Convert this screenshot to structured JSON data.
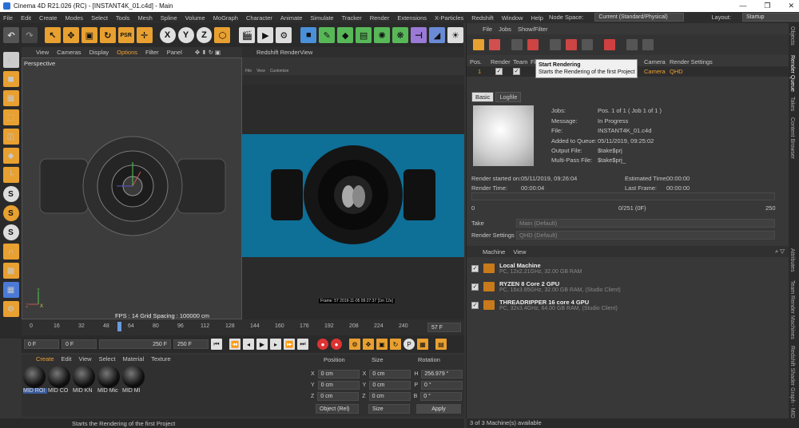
{
  "title": "Cinema 4D R21.026 (RC) - [INSTANT4K_01.c4d] - Main",
  "menu": [
    "File",
    "Edit",
    "Create",
    "Modes",
    "Select",
    "Tools",
    "Mesh",
    "Spline",
    "Volume",
    "MoGraph",
    "Character",
    "Animate",
    "Simulate",
    "Tracker",
    "Render",
    "Extensions",
    "X-Particles",
    "Redshift",
    "Window",
    "Help"
  ],
  "node_space": {
    "label": "Node Space:",
    "value": "Current (Standard/Physical)"
  },
  "layout": {
    "label": "Layout:",
    "value": "Startup"
  },
  "axis_buttons": [
    "X",
    "Y",
    "Z"
  ],
  "viewport": {
    "menu": [
      "View",
      "Cameras",
      "Display",
      "Options",
      "Filter",
      "Panel"
    ],
    "label": "Perspective",
    "fps": "FPS : 14",
    "grid": "Grid Spacing : 100000 cm"
  },
  "renderview": {
    "title": "Redshift RenderView",
    "menu": [
      "File",
      "View",
      "Customize"
    ],
    "frame_info": "Frame: 57  2019-11-05  09:27:37  [1m 12s]"
  },
  "timeline": {
    "ticks": [
      "0",
      "16",
      "32",
      "48",
      "64",
      "80",
      "96",
      "112",
      "128",
      "144",
      "160",
      "176",
      "192",
      "208",
      "224",
      "240"
    ],
    "current": "57 F"
  },
  "transport": {
    "start": "0 F",
    "current": "0 F",
    "end": "250 F",
    "end2": "250 F"
  },
  "materials": {
    "menu": [
      "Create",
      "Edit",
      "View",
      "Select",
      "Material",
      "Texture"
    ],
    "items": [
      "MID ROI",
      "MID CO",
      "MID KN",
      "MID Mic",
      "MID MI"
    ]
  },
  "coords": {
    "headers": [
      "Position",
      "Size",
      "Rotation"
    ],
    "rows": [
      {
        "axis": "X",
        "pos": "0 cm",
        "size_axis": "X",
        "size": "0 cm",
        "rot_axis": "H",
        "rot": "256.979 °"
      },
      {
        "axis": "Y",
        "pos": "0 cm",
        "size_axis": "Y",
        "size": "0 cm",
        "rot_axis": "P",
        "rot": "0 °"
      },
      {
        "axis": "Z",
        "pos": "0 cm",
        "size_axis": "Z",
        "size": "0 cm",
        "rot_axis": "B",
        "rot": "0 °"
      }
    ],
    "mode": "Object (Rel)",
    "size_mode": "Size",
    "apply": "Apply"
  },
  "status": "Starts the Rendering of the first Project",
  "render_queue": {
    "menu": [
      "File",
      "Jobs",
      "Show/Filter"
    ],
    "tooltip_title": "Start Rendering",
    "tooltip_body": "Starts the Rendering of the first Project",
    "columns": [
      "Pos.",
      "Render",
      "Team",
      "Fi",
      "Camera",
      "Render Settings"
    ],
    "row": {
      "pos": "1",
      "camera": "Camera",
      "settings": "QHD"
    },
    "tabs": [
      "Basic",
      "Logfile"
    ],
    "info": [
      {
        "k": "Jobs:",
        "v": "Pos. 1 of 1 ( Job 1 of 1 )"
      },
      {
        "k": "Message:",
        "v": "In Progress"
      },
      {
        "k": "File:",
        "v": "INSTANT4K_01.c4d"
      },
      {
        "k": "Added to Queue:",
        "v": "05/11/2019, 09:25:02"
      },
      {
        "k": "Output File:",
        "v": "$take$prj"
      },
      {
        "k": "Multi-Pass File:",
        "v": "$take$prj_"
      }
    ],
    "render_started_label": "Render started on:",
    "render_started": "05/11/2019, 09:26:04",
    "estimated_label": "Estimated Time:",
    "estimated": "00:00:00",
    "render_time_label": "Render Time:",
    "render_time": "00:00:04",
    "last_frame_label": "Last Frame:",
    "last_frame": "00:00:00",
    "progress_min": "0",
    "progress_text": "0/251 (0F)",
    "progress_max": "250",
    "progress_value": 0,
    "take_label": "Take",
    "take": "Main (Default)",
    "rs_label": "Render Settings",
    "rs": "QHD (Default)",
    "machine_menu": [
      "Machine",
      "View"
    ],
    "machines": [
      {
        "name": "Local Machine",
        "info": "PC, 12x2.21GHz, 32.00 GB RAM"
      },
      {
        "name": "RYZEN 8 Core 2 GPU",
        "info": "PC, 16x3.85GHz, 32.00 GB RAM, (Studio Client)"
      },
      {
        "name": "THREADRIPPER 16 core 4 GPU",
        "info": "PC, 32x3.4GHz, 64.00 GB RAM, (Studio Client)"
      }
    ],
    "machine_status": "3 of 3 Machine(s) available"
  },
  "side_tabs": [
    "Objects",
    "Render Queue",
    "Takes",
    "Content Browser",
    "Attributes",
    "Team Render Machines",
    "Redshift Shader Graph - MID"
  ],
  "colors": {
    "accent": "#f0a030",
    "render_bg": "#0e6f97"
  }
}
